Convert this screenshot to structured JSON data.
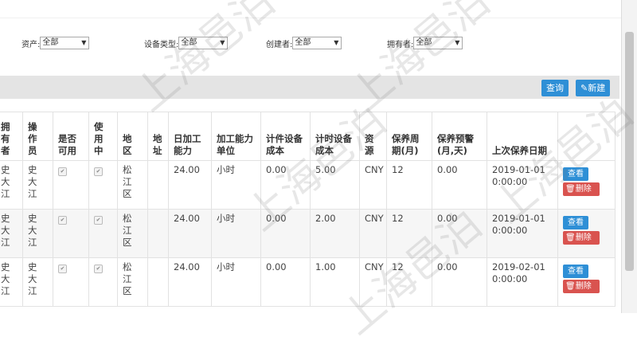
{
  "filters": [
    {
      "label": "资产:",
      "value": "全部"
    },
    {
      "label": "设备类型:",
      "value": "全部"
    },
    {
      "label": "创建者:",
      "value": "全部"
    },
    {
      "label": "拥有者:",
      "value": "全部"
    }
  ],
  "toolbar": {
    "query_label": "查询",
    "new_label": "新建"
  },
  "table": {
    "headers": [
      "拥有者",
      "操作员",
      "是否可用",
      "使用中",
      "地区",
      "地址",
      "日加工能力",
      "加工能力单位",
      "计件设备成本",
      "计时设备成本",
      "资源",
      "保养周期(月)",
      "保养预警(月,天)",
      "上次保养日期",
      ""
    ],
    "header_display": [
      "拥\n有\n者",
      "操\n作\n员",
      "是否\n可用",
      "使\n用\n中",
      "地\n区",
      "地\n址",
      "日加工\n能力",
      "加工能力\n单位",
      "计件设备\n成本",
      "计时设备\n成本",
      "资\n源",
      "保养周\n期(月)",
      "保养预警\n(月,天)",
      "上次保养日期",
      ""
    ],
    "rows": [
      {
        "owner": "史\n大\n江",
        "operator": "史\n大\n江",
        "region": "松\n江\n区",
        "capacity": "24.00",
        "unit": "小时",
        "piece_cost": "0.00",
        "time_cost": "5.00",
        "resource": "CNY",
        "cycle": "12",
        "warning": "0.00",
        "last_date": "2019-01-01\n0:00:00"
      },
      {
        "owner": "史\n大\n江",
        "operator": "史\n大\n江",
        "region": "松\n江\n区",
        "capacity": "24.00",
        "unit": "小时",
        "piece_cost": "0.00",
        "time_cost": "2.00",
        "resource": "CNY",
        "cycle": "12",
        "warning": "0.00",
        "last_date": "2019-01-01\n0:00:00"
      },
      {
        "owner": "史\n大\n江",
        "operator": "史\n大\n江",
        "region": "松\n江\n区",
        "capacity": "24.00",
        "unit": "小时",
        "piece_cost": "0.00",
        "time_cost": "1.00",
        "resource": "CNY",
        "cycle": "12",
        "warning": "0.00",
        "last_date": "2019-02-01\n0:00:00"
      }
    ],
    "view_label": "查看",
    "delete_label": "删除"
  },
  "watermark": "上海邑泊"
}
